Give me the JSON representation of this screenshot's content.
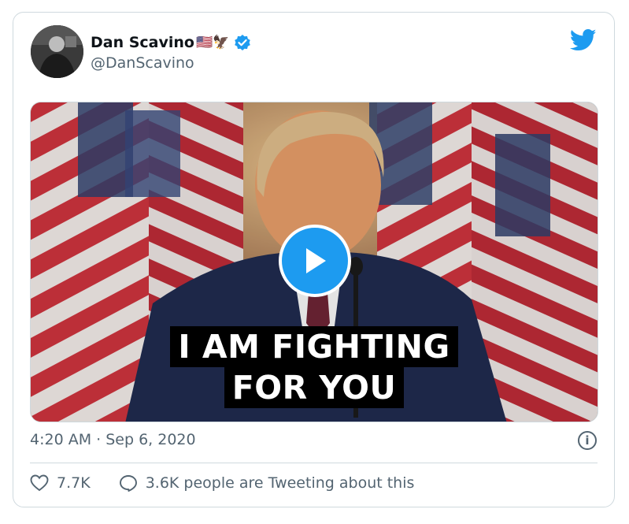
{
  "tweet": {
    "author_name": "Dan Scavino",
    "author_name_emoji": "🇺🇸🦅",
    "author_handle": "@DanScavino",
    "verified": true,
    "timestamp": "4:20 AM · Sep 6, 2020",
    "likes": "7.7K",
    "conversation": "3.6K people are Tweeting about this"
  },
  "media": {
    "caption_line1": "I AM FIGHTING",
    "caption_line2": "FOR YOU",
    "type": "video"
  },
  "colors": {
    "accent": "#1d9bf0",
    "text_primary": "#0f1419",
    "text_secondary": "#536471",
    "border": "#cfd9de"
  },
  "icons": [
    "twitter-bird-icon",
    "verified-badge-icon",
    "play-icon",
    "info-icon",
    "heart-icon",
    "reply-bubble-icon"
  ]
}
